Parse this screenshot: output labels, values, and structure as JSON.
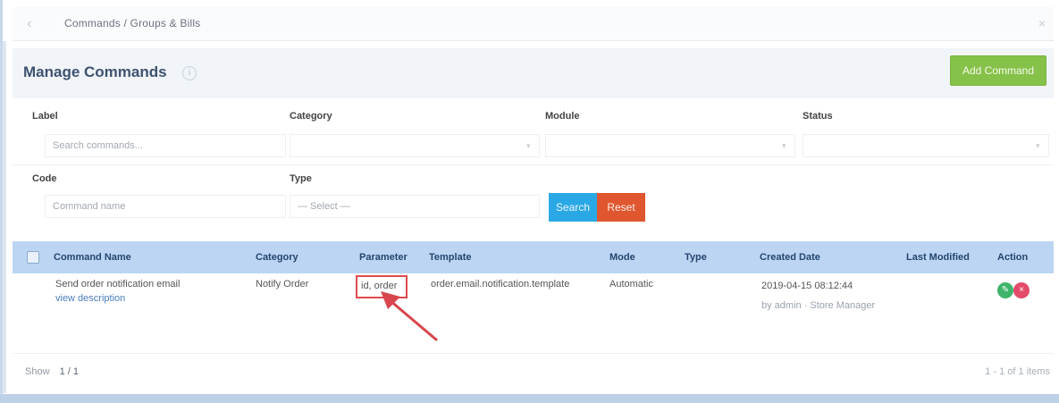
{
  "topbar": {
    "back_icon": "back-icon",
    "crumb": "Commands / Groups & Bills",
    "close_icon": "close-icon"
  },
  "header": {
    "title": "Manage Commands",
    "info_icon": "info-icon",
    "add_button": "Add Command"
  },
  "filters": {
    "labels": [
      "Label",
      "Category",
      "Module",
      "Status"
    ],
    "inputs": [
      "Search commands...",
      "",
      "",
      ""
    ],
    "row2_labels": [
      "Code",
      "Type"
    ],
    "row2_values": [
      "Command name",
      "— Select —"
    ],
    "search_button": "Search",
    "reset_button": "Reset"
  },
  "table": {
    "headers": [
      "Command Name",
      "Category",
      "Parameter",
      "Template",
      "Mode",
      "Type",
      "Created Date",
      "Last Modified",
      "Action"
    ],
    "rows": [
      {
        "name": "Send order notification email",
        "name_sub": "view description",
        "category": "Notify Order",
        "parameter": "id, order",
        "template": "order.email.notification.template",
        "mode": "Automatic",
        "type": "",
        "created": "2019-04-15 08:12:44",
        "created_sub": "by admin · Store Manager",
        "modified": "",
        "edit_icon": "edit-icon",
        "delete_icon": "delete-icon"
      }
    ]
  },
  "pager": {
    "left": "Show",
    "page": "1 / 1",
    "right": "1 - 1 of 1 items"
  },
  "colors": {
    "header_band": "#bcd5f3",
    "add_button": "#86c14a",
    "search_button": "#2aa8e6",
    "reset_button": "#e0562f",
    "highlight": "#e04b4b"
  }
}
